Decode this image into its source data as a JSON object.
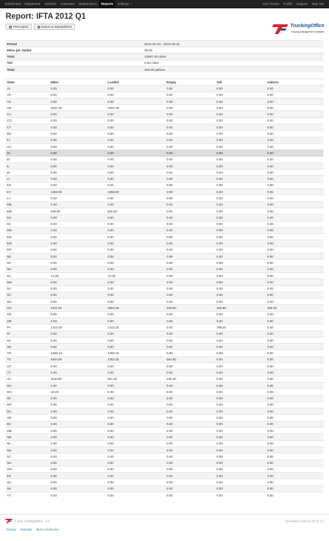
{
  "nav": {
    "left": [
      "Dashboard",
      "Dispatches",
      "Vehicles",
      "Expenses",
      "Maintenance",
      "Reports",
      "Settings"
    ],
    "active": "Reports",
    "right": [
      "Your Trucks",
      "Profile",
      "Support",
      "Sign Out"
    ]
  },
  "header": {
    "title": "Report: IFTA 2012 Q1",
    "print_label": "Print report",
    "export_label": "Export to Spreadsheet"
  },
  "logo": {
    "name": "TruckingOffice",
    "tagline": "Trucking Management Software"
  },
  "colors": {
    "brand_red": "#d9232a",
    "brand_blue": "#1d4f91",
    "navbar": "#222222"
  },
  "summary": [
    {
      "label": "Period",
      "value": "2012-01-01 - 2012-03-31"
    },
    {
      "label": "Miles per Gallon",
      "value": "39.56"
    },
    {
      "label": "Total",
      "value": "12867.40 miles"
    },
    {
      "label": "Toll",
      "value": "0.00 miles"
    },
    {
      "label": "Total",
      "value": "325.00 gallons"
    }
  ],
  "states": {
    "columns": [
      "State",
      "Miles",
      "Loaded",
      "Empty",
      "Toll",
      "Gallons"
    ],
    "rows": [
      [
        "AL",
        "0.00",
        "0.00",
        "0.00",
        "0.00",
        "0.00"
      ],
      [
        "AK",
        "0.00",
        "0.00",
        "0.00",
        "0.00",
        "0.00"
      ],
      [
        "AZ",
        "0.00",
        "0.00",
        "0.00",
        "0.00",
        "0.00"
      ],
      [
        "AR",
        "1637.40",
        "1637.40",
        "0.00",
        "0.00",
        "0.00"
      ],
      [
        "CA",
        "0.00",
        "0.00",
        "0.00",
        "0.00",
        "0.00"
      ],
      [
        "CO",
        "0.00",
        "0.00",
        "0.00",
        "0.00",
        "0.00"
      ],
      [
        "CT",
        "0.00",
        "0.00",
        "0.00",
        "0.00",
        "0.00"
      ],
      [
        "DE",
        "0.00",
        "0.00",
        "0.00",
        "0.00",
        "0.00"
      ],
      [
        "FL",
        "0.00",
        "0.00",
        "0.00",
        "0.00",
        "0.00"
      ],
      [
        "GA",
        "0.00",
        "0.00",
        "0.00",
        "0.00",
        "0.00"
      ],
      [
        "HI",
        "0.00",
        "0.00",
        "0.00",
        "0.00",
        "0.00"
      ],
      [
        "ID",
        "0.00",
        "0.00",
        "0.00",
        "0.00",
        "0.00"
      ],
      [
        "IL",
        "0.00",
        "0.00",
        "0.00",
        "0.00",
        "0.00"
      ],
      [
        "IN",
        "0.00",
        "0.00",
        "0.00",
        "0.00",
        "0.00"
      ],
      [
        "IA",
        "0.00",
        "0.00",
        "0.00",
        "0.00",
        "0.00"
      ],
      [
        "KS",
        "0.00",
        "0.00",
        "0.00",
        "0.00",
        "0.00"
      ],
      [
        "KY",
        "1393.80",
        "1393.80",
        "0.00",
        "0.00",
        "0.00"
      ],
      [
        "LA",
        "0.00",
        "0.00",
        "0.00",
        "0.00",
        "0.00"
      ],
      [
        "ME",
        "0.00",
        "0.00",
        "0.00",
        "0.00",
        "0.00"
      ],
      [
        "MD",
        "529.50",
        "529.50",
        "0.00",
        "0.00",
        "0.00"
      ],
      [
        "MA",
        "0.00",
        "0.00",
        "0.00",
        "0.00",
        "0.00"
      ],
      [
        "MI",
        "0.00",
        "0.00",
        "0.00",
        "0.00",
        "0.00"
      ],
      [
        "MN",
        "0.00",
        "0.00",
        "0.00",
        "0.00",
        "0.00"
      ],
      [
        "MS",
        "0.00",
        "0.00",
        "0.00",
        "0.00",
        "0.00"
      ],
      [
        "MO",
        "0.00",
        "0.00",
        "0.00",
        "0.00",
        "0.00"
      ],
      [
        "MT",
        "0.00",
        "0.00",
        "0.00",
        "0.00",
        "0.00"
      ],
      [
        "NE",
        "0.00",
        "0.00",
        "0.00",
        "0.00",
        "0.00"
      ],
      [
        "NV",
        "0.00",
        "0.00",
        "0.00",
        "0.00",
        "0.00"
      ],
      [
        "NH",
        "0.00",
        "0.00",
        "0.00",
        "0.00",
        "0.00"
      ],
      [
        "NJ",
        "72.30",
        "72.30",
        "0.00",
        "0.00",
        "0.00"
      ],
      [
        "NM",
        "0.00",
        "0.00",
        "0.00",
        "0.00",
        "0.00"
      ],
      [
        "NY",
        "9.30",
        "9.30",
        "0.00",
        "0.40",
        "0.00"
      ],
      [
        "NC",
        "0.00",
        "0.00",
        "0.00",
        "0.00",
        "0.00"
      ],
      [
        "ND",
        "0.00",
        "0.00",
        "0.00",
        "0.00",
        "0.00"
      ],
      [
        "OH",
        "2311.00",
        "1961.50",
        "349.50",
        "160.80",
        "325.00"
      ],
      [
        "OK",
        "0.00",
        "0.00",
        "0.00",
        "0.00",
        "0.00"
      ],
      [
        "OR",
        "0.00",
        "0.00",
        "0.00",
        "0.00",
        "0.00"
      ],
      [
        "PA",
        "1413.20",
        "1413.20",
        "0.00",
        "799.20",
        "0.00"
      ],
      [
        "RI",
        "0.00",
        "0.00",
        "0.00",
        "0.00",
        "0.00"
      ],
      [
        "SC",
        "0.00",
        "0.00",
        "0.00",
        "0.00",
        "0.00"
      ],
      [
        "SD",
        "0.00",
        "0.00",
        "0.00",
        "0.00",
        "0.00"
      ],
      [
        "TN",
        "1450.10",
        "1450.10",
        "0.00",
        "0.00",
        "0.00"
      ],
      [
        "TX",
        "2844.00",
        "2252.40",
        "591.60",
        "0.00",
        "0.00"
      ],
      [
        "UT",
        "0.00",
        "0.00",
        "0.00",
        "0.00",
        "0.00"
      ],
      [
        "VT",
        "0.00",
        "0.00",
        "0.00",
        "0.00",
        "0.00"
      ],
      [
        "VA",
        "1146.60",
        "911.40",
        "235.20",
        "0.00",
        "0.00"
      ],
      [
        "WA",
        "0.00",
        "0.00",
        "0.00",
        "0.00",
        "0.00"
      ],
      [
        "WV",
        "10.20",
        "0.00",
        "0.00",
        "0.00",
        "0.00"
      ],
      [
        "WI",
        "0.00",
        "0.00",
        "0.00",
        "0.00",
        "0.00"
      ],
      [
        "WY",
        "0.00",
        "0.00",
        "0.00",
        "0.00",
        "0.00"
      ],
      [
        "DC",
        "0.00",
        "0.00",
        "0.00",
        "0.00",
        "0.00"
      ],
      [
        "AB",
        "0.00",
        "0.00",
        "0.00",
        "0.00",
        "0.00"
      ],
      [
        "BC",
        "0.00",
        "0.00",
        "0.00",
        "0.00",
        "0.00"
      ],
      [
        "MB",
        "0.00",
        "0.00",
        "0.00",
        "0.00",
        "0.00"
      ],
      [
        "NB",
        "0.00",
        "0.00",
        "0.00",
        "0.00",
        "0.00"
      ],
      [
        "NL",
        "0.00",
        "0.00",
        "0.00",
        "0.00",
        "0.00"
      ],
      [
        "NS",
        "0.00",
        "0.00",
        "0.00",
        "0.00",
        "0.00"
      ],
      [
        "NT",
        "0.00",
        "0.00",
        "0.00",
        "0.00",
        "0.00"
      ],
      [
        "NU",
        "0.00",
        "0.00",
        "0.00",
        "0.00",
        "0.00"
      ],
      [
        "ON",
        "0.00",
        "0.00",
        "0.00",
        "0.00",
        "0.00"
      ],
      [
        "PE",
        "0.00",
        "0.00",
        "0.00",
        "0.00",
        "0.00"
      ],
      [
        "QC",
        "0.00",
        "0.00",
        "0.00",
        "0.00",
        "0.00"
      ],
      [
        "SK",
        "0.00",
        "0.00",
        "0.00",
        "0.00",
        "0.00"
      ],
      [
        "YT",
        "0.00",
        "0.00",
        "0.00",
        "0.00",
        "0.00"
      ]
    ],
    "highlighted_row": 10
  },
  "footer": {
    "copyright": "© 2012 TruckingOffice · 1.0",
    "generated": "Generated: 2012-07-09 ID 3-1",
    "links": [
      "Privacy",
      "Refunds",
      "Terms of Service"
    ]
  }
}
